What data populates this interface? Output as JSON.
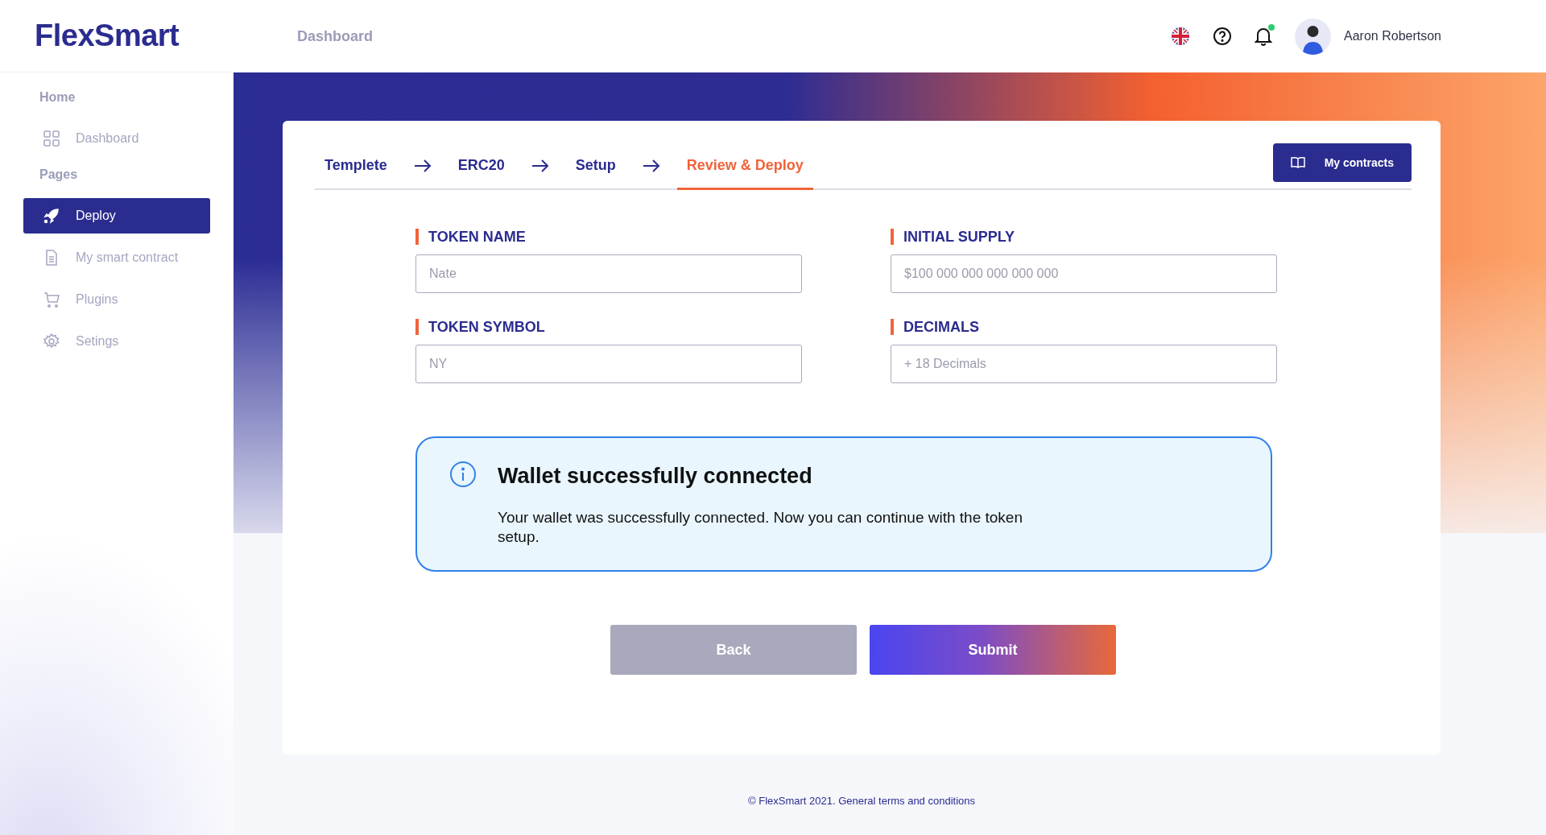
{
  "header": {
    "logo": "FlexSmart",
    "breadcrumb": "Dashboard",
    "user_name": "Aaron Robertson",
    "has_notification": true
  },
  "sidebar": {
    "sections": [
      {
        "title": "Home",
        "items": [
          {
            "label": "Dashboard",
            "selected": false
          }
        ]
      },
      {
        "title": "Pages",
        "items": [
          {
            "label": "Deploy",
            "selected": true
          },
          {
            "label": "My smart contract",
            "selected": false
          },
          {
            "label": "Plugins",
            "selected": false
          },
          {
            "label": "Setings",
            "selected": false
          }
        ]
      }
    ]
  },
  "steps": [
    {
      "label": "Templete",
      "selected": false
    },
    {
      "label": "ERC20",
      "selected": false
    },
    {
      "label": "Setup",
      "selected": false
    },
    {
      "label": "Review & Deploy",
      "selected": true
    }
  ],
  "contracts_button": "My contracts",
  "fields": [
    {
      "label": "TOKEN NAME",
      "placeholder": "Nate"
    },
    {
      "label": "INITIAL SUPPLY",
      "placeholder": "$100 000 000 000 000 000"
    },
    {
      "label": "TOKEN SYMBOL",
      "placeholder": "NY"
    },
    {
      "label": "DECIMALS",
      "placeholder": "+ 18 Decimals"
    }
  ],
  "alert": {
    "title": "Wallet successfully connected",
    "message": "Your wallet was successfully connected. Now you can continue with the token setup."
  },
  "buttons": [
    {
      "label": "Back",
      "kind": "secondary"
    },
    {
      "label": "Submit",
      "kind": "primary"
    }
  ],
  "footer": "© FlexSmart 2021. General terms and conditions"
}
